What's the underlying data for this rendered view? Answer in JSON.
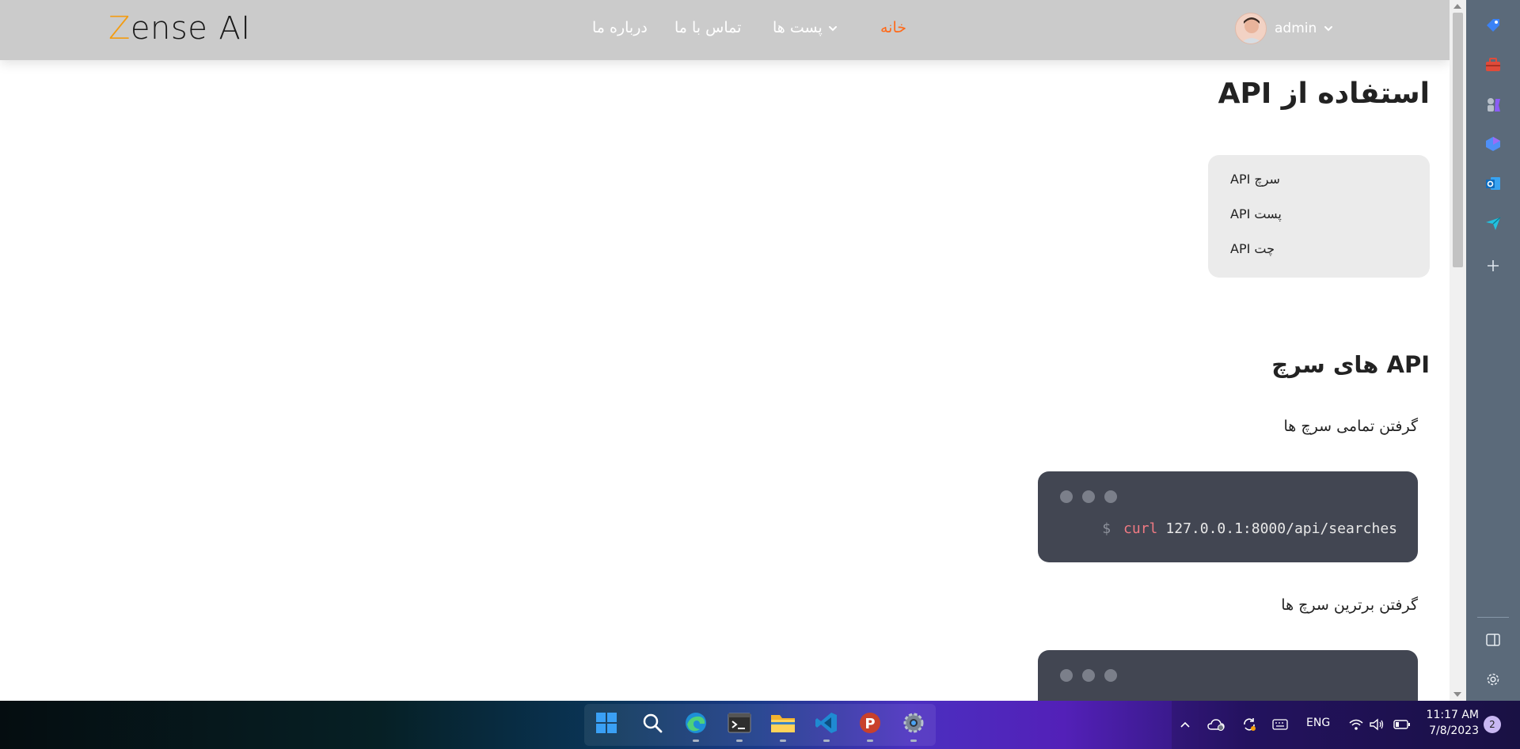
{
  "navbar": {
    "logo_z": "Z",
    "logo_rest": "ense",
    "logo_ai": "AI",
    "links": {
      "home": "خانه",
      "posts": "پست ها",
      "contact": "تماس با ما",
      "about": "درباره ما"
    },
    "username": "admin"
  },
  "content": {
    "page_title": "استفاده از API",
    "toc": [
      "سرچ API",
      "پست API",
      "چت API"
    ],
    "section_title": "API های سرچ",
    "sub1": "گرفتن تمامی سرچ ها",
    "sub2": "گرفتن برترین سرچ ها",
    "code1": {
      "prompt": "$",
      "cmd": "curl",
      "arg": "127.0.0.1:8000/api/searches"
    }
  },
  "taskbar": {
    "lang": "ENG",
    "time": "11:17 AM",
    "date": "7/8/2023",
    "notifications": "2"
  },
  "colors": {
    "accent": "#ff6a1a",
    "navbar_bg": "#cbcbcb",
    "code_bg": "#424652",
    "sidepanel_bg": "#5b6a7a"
  }
}
